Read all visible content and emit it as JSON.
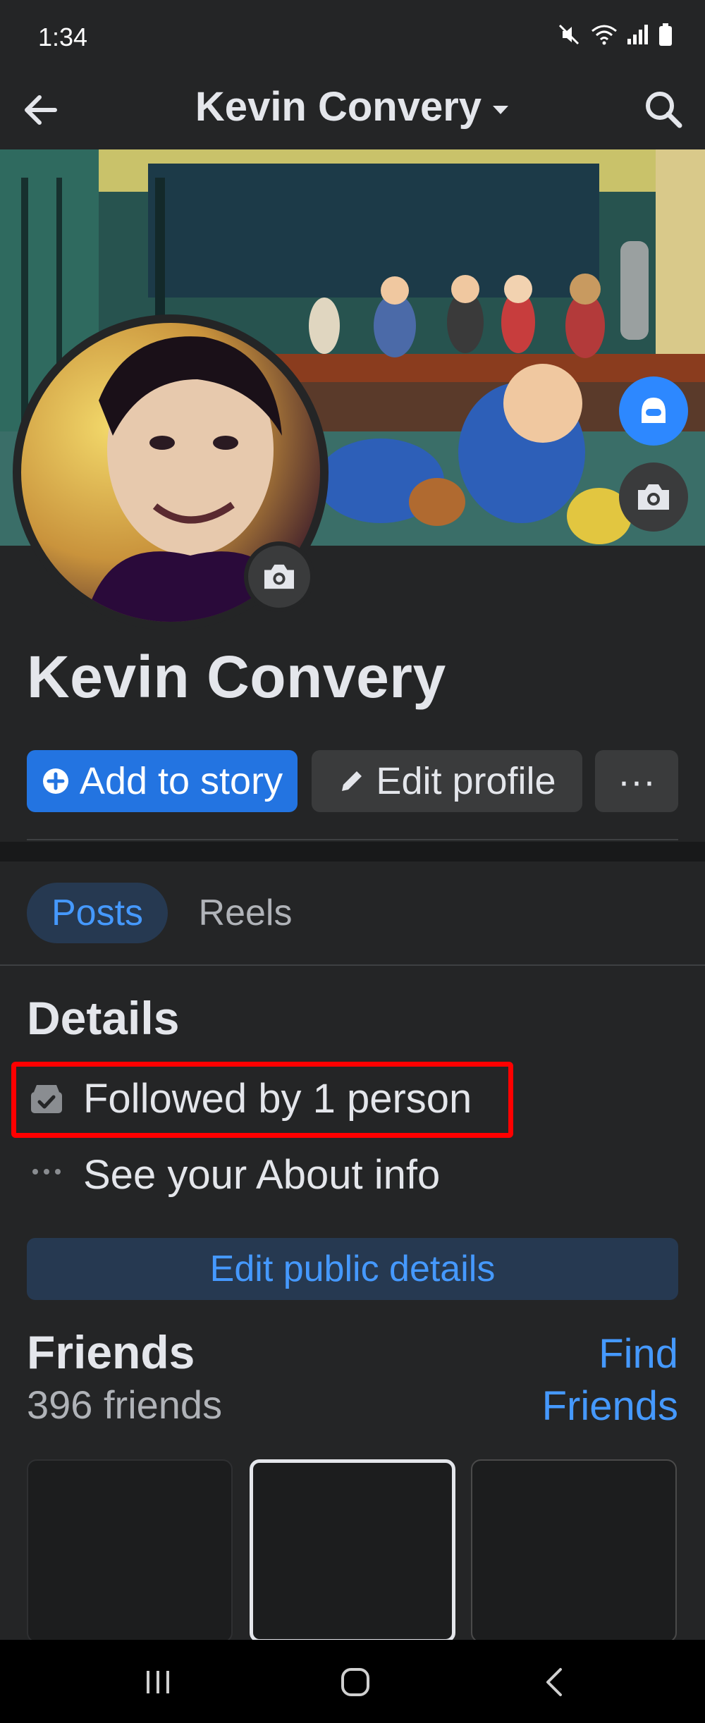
{
  "status_bar": {
    "time": "1:34"
  },
  "header": {
    "title": "Kevin Convery"
  },
  "profile": {
    "name": "Kevin Convery",
    "add_to_story_label": "Add to story",
    "edit_profile_label": "Edit profile",
    "more_label": "···"
  },
  "tabs": [
    {
      "label": "Posts",
      "selected": true
    },
    {
      "label": "Reels",
      "selected": false
    }
  ],
  "details": {
    "title": "Details",
    "followed_by": "Followed by 1 person",
    "about_link": "See your About info",
    "edit_public_label": "Edit public details"
  },
  "friends": {
    "title": "Friends",
    "count": "396 friends",
    "find_friends_label": "Find Friends"
  },
  "colors": {
    "background": "#242526",
    "accent": "#2374e1",
    "link": "#4599ff",
    "highlight": "#ff0000"
  },
  "icons": [
    "back-arrow-icon",
    "caret-down-icon",
    "search-icon",
    "plus-circle-icon",
    "pencil-icon",
    "more-icon",
    "camera-icon",
    "avatar-icon",
    "followers-icon",
    "dots-icon"
  ]
}
